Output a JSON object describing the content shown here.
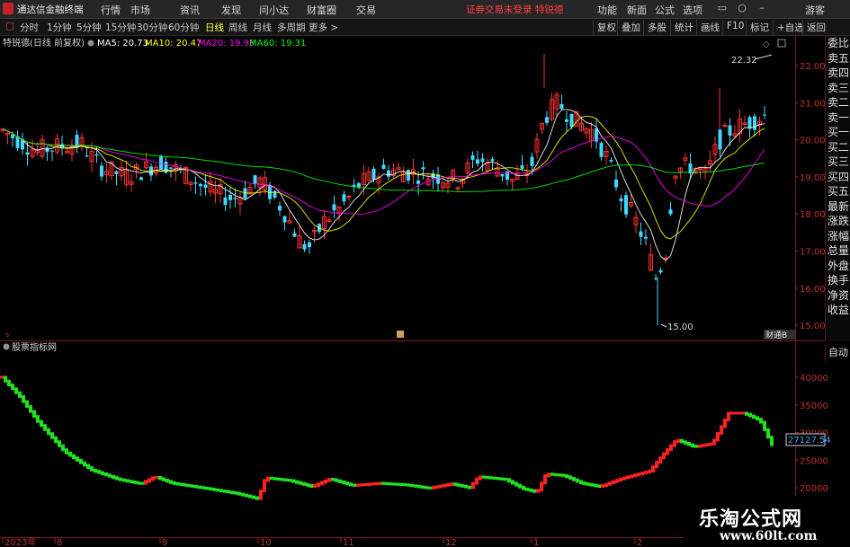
{
  "window": {
    "app_title": "通达信金融终端",
    "guest_label": "游客"
  },
  "menu": {
    "items": [
      "行情",
      "市场",
      "资讯",
      "发现",
      "问小达",
      "财富圈",
      "交易"
    ],
    "notice": "证券交易未登录  特锐德",
    "right_items": [
      "功能",
      "新面",
      "公式",
      "选项"
    ]
  },
  "toolbar": {
    "periods": [
      "分时",
      "1分钟",
      "5分钟",
      "15分钟",
      "30分钟",
      "60分钟",
      "日线",
      "周线",
      "月线",
      "多周期",
      "更多 >"
    ],
    "active_period": "日线",
    "right_items": [
      "复权",
      "叠加",
      "多股",
      "统计",
      "画线",
      "F10",
      "标记",
      "+自选",
      "返回"
    ]
  },
  "main_chart": {
    "stock_name": "特锐德(日线 前复权)",
    "ma": [
      {
        "label": "MA5: 20.73",
        "color": "#ffffff"
      },
      {
        "label": "MA10: 20.47",
        "color": "#ffff00"
      },
      {
        "label": "MA20: 19.93",
        "color": "#ff00ff"
      },
      {
        "label": "MA60: 19.31",
        "color": "#00ff00"
      }
    ],
    "price_ticks": [
      "22.00",
      "21.00",
      "20.00",
      "19.00",
      "18.00",
      "17.00",
      "16.00",
      "15.00"
    ],
    "high_label": "22.32",
    "low_label": "15.00",
    "bottom_tag": "财通B"
  },
  "indicator": {
    "name": "股票指标网",
    "ticks": [
      "40000",
      "35000",
      "30000",
      "25000",
      "20000"
    ],
    "current_value": "27127.54",
    "colors": {
      "up": "#ff2020",
      "down": "#20e020"
    }
  },
  "xaxis": {
    "labels": [
      "2023年",
      "8",
      "9",
      "10",
      "11",
      "12",
      "1",
      "2"
    ]
  },
  "side_panel": {
    "items": [
      "委比",
      "卖五",
      "卖四",
      "卖三",
      "卖二",
      "卖一",
      "买一",
      "买二",
      "买三",
      "买四",
      "买五",
      "最新",
      "涨跌",
      "涨幅",
      "总量",
      "外盘",
      "换手",
      "净资",
      "收益"
    ],
    "auto_label": "自动"
  },
  "watermark": {
    "line1": "乐淘公式网",
    "line2": "www.60lt.com"
  }
}
